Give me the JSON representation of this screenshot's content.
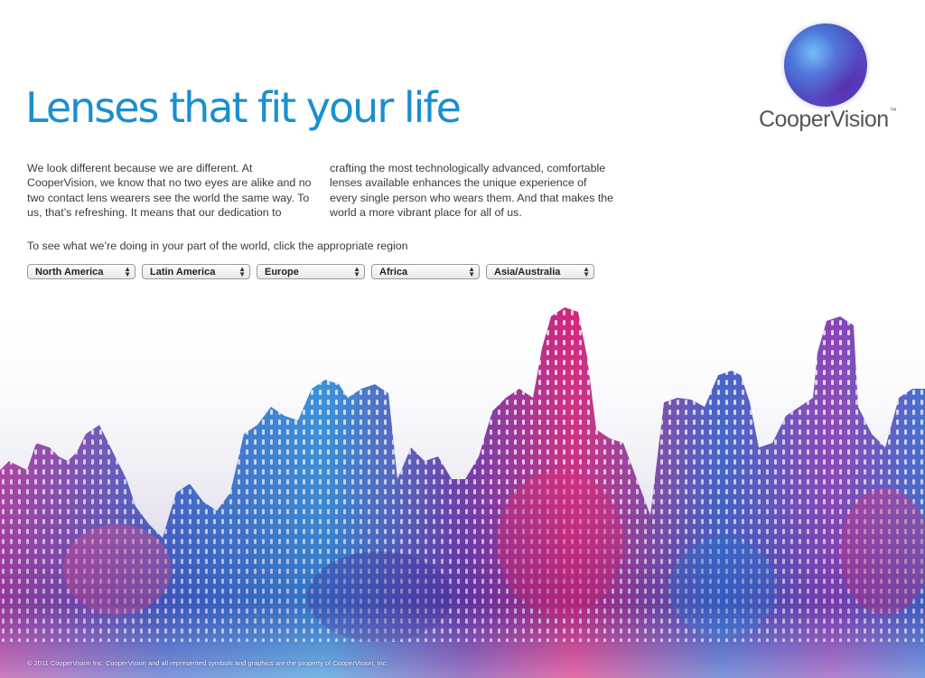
{
  "headline": "Lenses that fit your life",
  "brand": {
    "name": "CooperVision",
    "trademark": "™"
  },
  "intro": "We look different because we are different. At CooperVision, we know that no two eyes are alike and no two contact lens wearers see the world the same way. To us, that’s refreshing. It means that our dedication to crafting the most technologically advanced, comfortable lenses available enhances the unique experience of every single person who wears them. And that makes the world a more vibrant place for all of us.",
  "region_prompt": "To see what we’re doing in your part of the world, click the appropriate region",
  "regions": [
    {
      "label": "North America"
    },
    {
      "label": "Latin America"
    },
    {
      "label": "Europe"
    },
    {
      "label": "Africa"
    },
    {
      "label": "Asia/Australia"
    }
  ],
  "footer": "© 2011 CooperVision Inc. CooperVision and all represented symbols and graphics are the property of CooperVision, Inc.",
  "colors": {
    "headline": "#1a8fcf",
    "skyline_blue": "#2f63c8",
    "skyline_purple": "#6a35a8",
    "skyline_magenta": "#d4247a"
  }
}
